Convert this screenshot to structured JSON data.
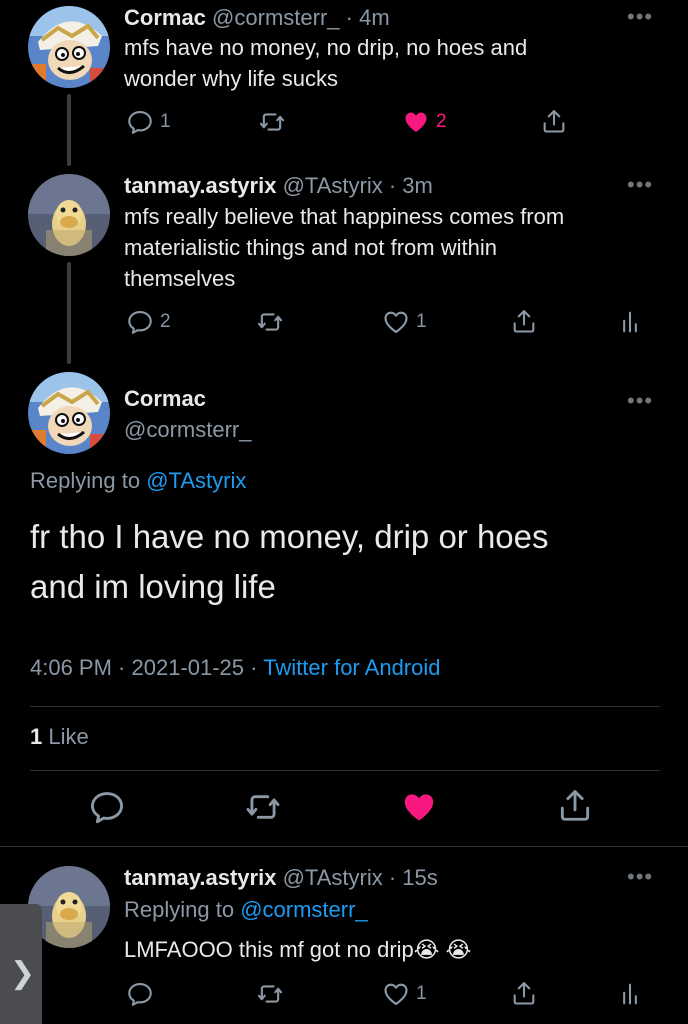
{
  "thread": {
    "tweet1": {
      "name": "Cormac",
      "handle": "@cormsterr_",
      "time": "· 4m",
      "lines": [
        "mfs have no money, no drip, no hoes and",
        "wonder why life sucks"
      ],
      "reply_count": "1",
      "like_count": "2",
      "liked": true
    },
    "tweet2": {
      "name": "tanmay.astyrix",
      "handle": "@TAstyrix",
      "time": "· 3m",
      "lines": [
        "mfs really believe that happiness comes from",
        "materialistic things and not from within",
        "themselves"
      ],
      "reply_count": "2",
      "like_count": "1"
    }
  },
  "focused": {
    "name": "Cormac",
    "handle": "@cormsterr_",
    "replying_prefix": "Replying to",
    "replying_handle": "@TAstyrix",
    "lines": [
      "fr tho I have no money, drip or hoes",
      "and im loving life"
    ],
    "timestamp": "4:06 PM · 2021-01-25 ·",
    "source": "Twitter for Android",
    "likes_count": "1",
    "likes_label": "Like",
    "liked": true
  },
  "reply": {
    "name": "tanmay.astyrix",
    "handle": "@TAstyrix",
    "time": "· 15s",
    "replying_prefix": "Replying to",
    "replying_handle": "@cormsterr_",
    "text": "LMFAOOO this mf got no drip",
    "emojis": [
      "😭",
      "😭"
    ],
    "like_count": "1"
  },
  "more_glyph": "•••",
  "side_arrow": "❯",
  "colors": {
    "background": "#000000",
    "text": "#e7e9ea",
    "muted": "#8b98a5",
    "link": "#1d9bf0",
    "like": "#f91880"
  },
  "icons": [
    "reply-icon",
    "retweet-icon",
    "like-icon",
    "share-icon",
    "analytics-icon",
    "more-icon",
    "chevron-right-icon"
  ]
}
